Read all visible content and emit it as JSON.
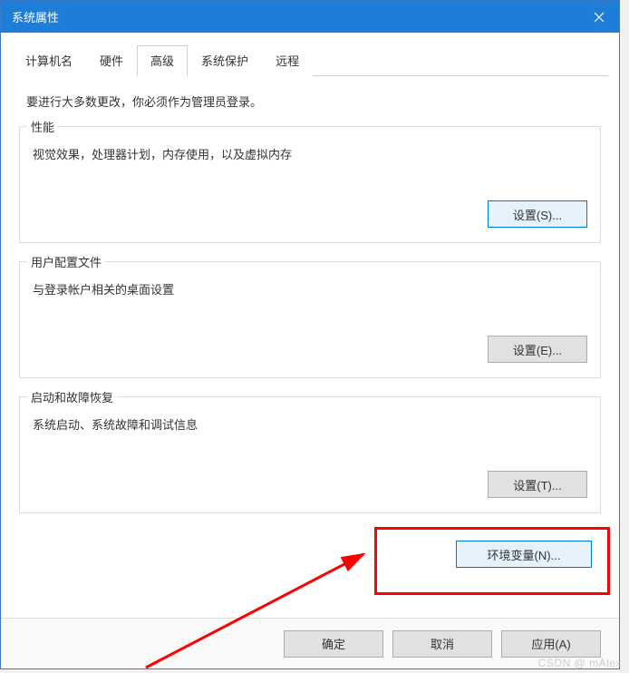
{
  "window": {
    "title": "系统属性"
  },
  "tabs": {
    "computer_name": "计算机名",
    "hardware": "硬件",
    "advanced": "高级",
    "system_protection": "系统保护",
    "remote": "远程"
  },
  "content": {
    "intro": "要进行大多数更改，你必须作为管理员登录。",
    "performance": {
      "title": "性能",
      "desc": "视觉效果，处理器计划，内存使用，以及虚拟内存",
      "button": "设置(S)..."
    },
    "user_profiles": {
      "title": "用户配置文件",
      "desc": "与登录帐户相关的桌面设置",
      "button": "设置(E)..."
    },
    "startup": {
      "title": "启动和故障恢复",
      "desc": "系统启动、系统故障和调试信息",
      "button": "设置(T)..."
    },
    "env_vars_button": "环境变量(N)..."
  },
  "footer": {
    "ok": "确定",
    "cancel": "取消",
    "apply": "应用(A)"
  },
  "watermark": "CSDN @ mAlex"
}
